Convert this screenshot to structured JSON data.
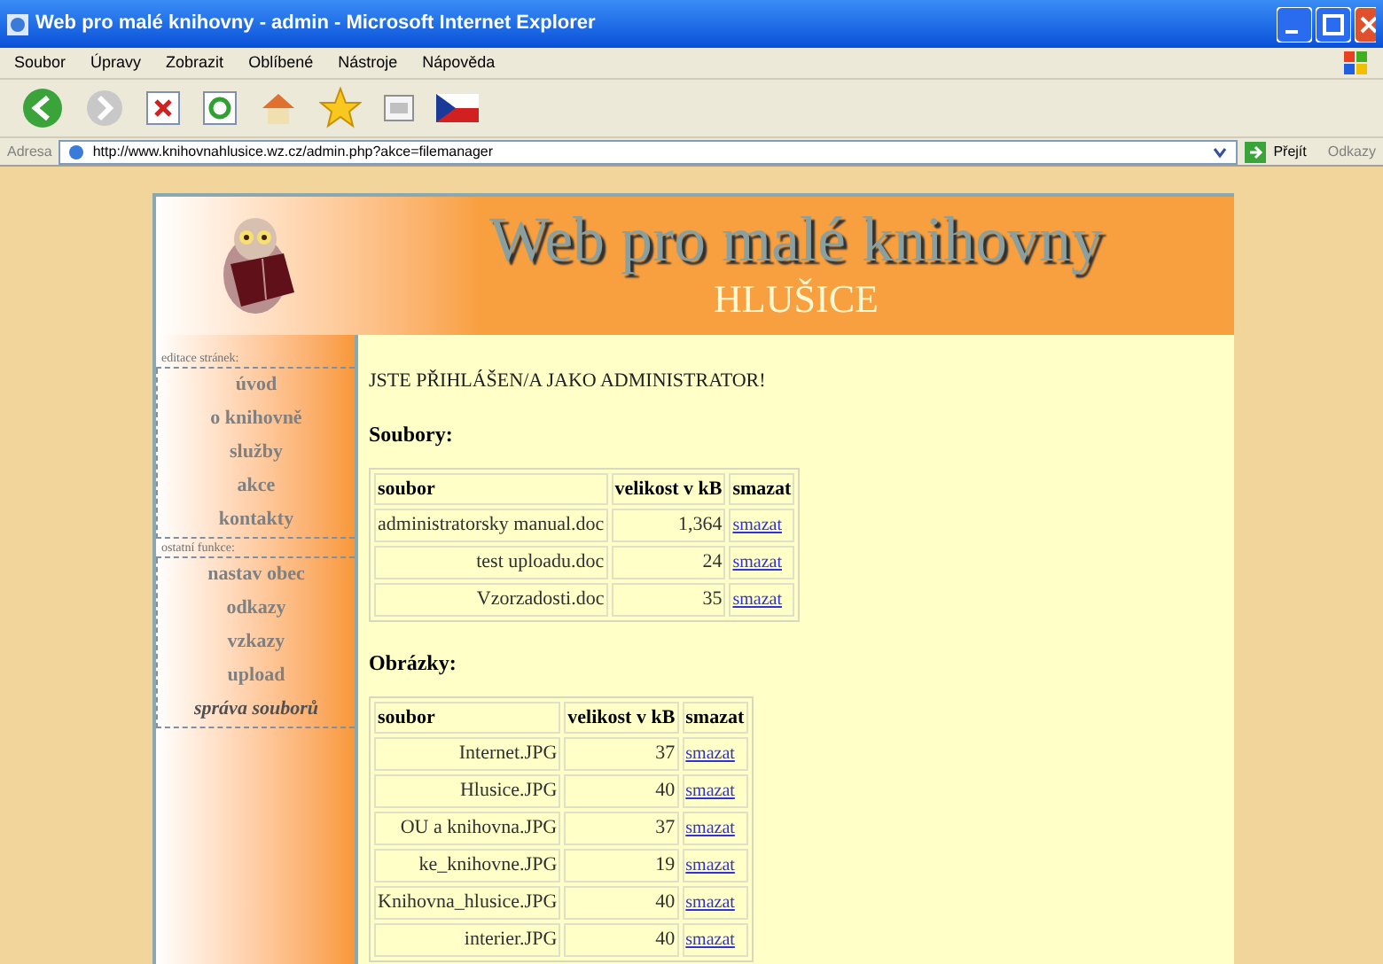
{
  "window": {
    "title": "Web pro malé knihovny - admin - Microsoft Internet Explorer"
  },
  "menu": [
    "Soubor",
    "Úpravy",
    "Zobrazit",
    "Oblíbené",
    "Nástroje",
    "Nápověda"
  ],
  "address": {
    "label": "Adresa",
    "value": "http://www.knihovnahlusice.wz.cz/admin.php?akce=filemanager",
    "go": "Přejít",
    "links": "Odkazy"
  },
  "header": {
    "title": "Web pro malé knihovny",
    "subtitle": "HLUŠICE"
  },
  "sidebar": [
    {
      "heading": "editace stránek:",
      "items": [
        {
          "label": "úvod",
          "selected": false
        },
        {
          "label": "o knihovně",
          "selected": false
        },
        {
          "label": "služby",
          "selected": false
        },
        {
          "label": "akce",
          "selected": false
        },
        {
          "label": "kontakty",
          "selected": false
        }
      ]
    },
    {
      "heading": "ostatní funkce:",
      "items": [
        {
          "label": "nastav obec",
          "selected": false
        },
        {
          "label": "odkazy",
          "selected": false
        },
        {
          "label": "vzkazy",
          "selected": false
        },
        {
          "label": "upload",
          "selected": false
        },
        {
          "label": "správa souborů",
          "selected": true
        }
      ]
    }
  ],
  "notice": "JSTE PŘIHLÁŠEN/A JAKO ADMINISTRATOR!",
  "sections": [
    {
      "title": "Soubory:",
      "columns": [
        "soubor",
        "velikost v kB",
        "smazat"
      ],
      "rows": [
        {
          "file": "administratorsky manual.doc",
          "size": "1,364",
          "action": "smazat"
        },
        {
          "file": "test uploadu.doc",
          "size": "24",
          "action": "smazat"
        },
        {
          "file": "Vzorzadosti.doc",
          "size": "35",
          "action": "smazat"
        }
      ]
    },
    {
      "title": "Obrázky:",
      "columns": [
        "soubor",
        "velikost v kB",
        "smazat"
      ],
      "rows": [
        {
          "file": "Internet.JPG",
          "size": "37",
          "action": "smazat"
        },
        {
          "file": "Hlusice.JPG",
          "size": "40",
          "action": "smazat"
        },
        {
          "file": "OU a knihovna.JPG",
          "size": "37",
          "action": "smazat"
        },
        {
          "file": "ke_knihovne.JPG",
          "size": "19",
          "action": "smazat"
        },
        {
          "file": "Knihovna_hlusice.JPG",
          "size": "40",
          "action": "smazat"
        },
        {
          "file": "interier.JPG",
          "size": "40",
          "action": "smazat"
        }
      ]
    }
  ]
}
